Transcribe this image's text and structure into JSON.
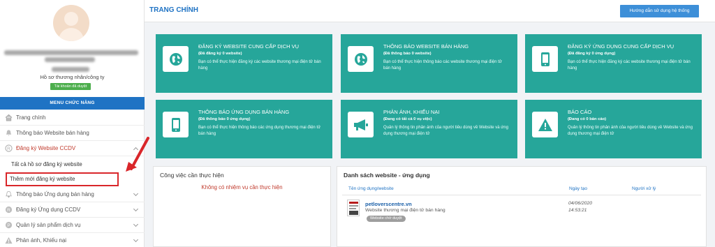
{
  "sidebar": {
    "profile_type": "Hồ sơ thương nhân/công ty",
    "badge": "Tài khoản đã duyệt",
    "menu_header": "MENU CHỨC NĂNG",
    "items": [
      {
        "label": "Trang chính",
        "icon": "home-icon"
      },
      {
        "label": "Thông báo Website bán hàng",
        "icon": "bell-icon"
      },
      {
        "label": "Đăng ký Website CCDV",
        "icon": "registered-icon"
      },
      {
        "label": "Thông báo Ứng dụng bán hàng",
        "icon": "bell-icon"
      },
      {
        "label": "Đăng ký Ứng dụng CCDV",
        "icon": "registered-icon"
      },
      {
        "label": "Quản lý sản phẩm dịch vụ",
        "icon": "product-icon"
      },
      {
        "label": "Phản ánh, Khiếu nại",
        "icon": "warning-icon"
      }
    ],
    "sub_items": [
      {
        "label": "Tất cả hồ sơ đăng ký website"
      },
      {
        "label": "Thêm mới đăng ký website"
      }
    ]
  },
  "header": {
    "title": "TRANG CHÍNH",
    "guide_button": "Hướng dẫn sử dụng hệ thống"
  },
  "cards": [
    {
      "title": "ĐĂNG KÝ WEBSITE CUNG CẤP DỊCH VỤ",
      "count": "(Đã đăng ký 0 website)",
      "desc": "Bạn có thể thực hiện đăng ký các website thương mại điện tử bán hàng",
      "icon": "globe-icon"
    },
    {
      "title": "THÔNG BÁO WEBSITE BÁN HÀNG",
      "count": "(Đã thông báo 0 website)",
      "desc": "Bạn có thể thực hiện thông báo các website thương mại điện tử bán hàng",
      "icon": "globe-icon"
    },
    {
      "title": "ĐĂNG KÝ ỨNG DỤNG CUNG CẤP DỊCH VỤ",
      "count": "(Đã đăng ký 0 ứng dụng)",
      "desc": "Bạn có thể thực hiện đăng ký các website thương mại điện tử bán hàng",
      "icon": "mobile-icon"
    },
    {
      "title": "THÔNG BÁO ỨNG DỤNG BÁN HÀNG",
      "count": "(Đã thông báo 0 ứng dụng)",
      "desc": "Bạn có thể thực hiện thông báo các ứng dụng thương mại điện tử bán hàng",
      "icon": "mobile-icon"
    },
    {
      "title": "PHẢN ÁNH, KHIẾU NẠI",
      "count": "(Đang có tất cả 0 vụ việc)",
      "desc": "Quản lý thông tin phản ánh của người tiêu dùng về Website và ứng dụng thương mại điện tử",
      "icon": "megaphone-icon"
    },
    {
      "title": "BÁO CÁO",
      "count": "(Đang có 0 bản cáo)",
      "desc": "Quản lý thông tin phản ánh của người tiêu dùng về Website và ứng dụng thương mại điện tử",
      "icon": "warning-icon"
    }
  ],
  "tasks": {
    "title": "Công việc cần thực hiện",
    "empty": "Không có nhiệm vụ cần thực hiện"
  },
  "sites": {
    "title": "Danh sách website - ứng dụng",
    "columns": [
      "Tên ứng dụng/website",
      "Ngày tạo",
      "Người xử lý"
    ],
    "rows": [
      {
        "name": "petloverscentre.vn",
        "desc": "Website thương mại điện tử bán hàng",
        "status": "Website chờ duyệt",
        "date": "04/06/2020",
        "time": "14:53:21"
      }
    ]
  },
  "colors": {
    "accent": "#1f73c4",
    "card": "#26a69a",
    "danger": "#d9262a",
    "success": "#4cae4c"
  }
}
